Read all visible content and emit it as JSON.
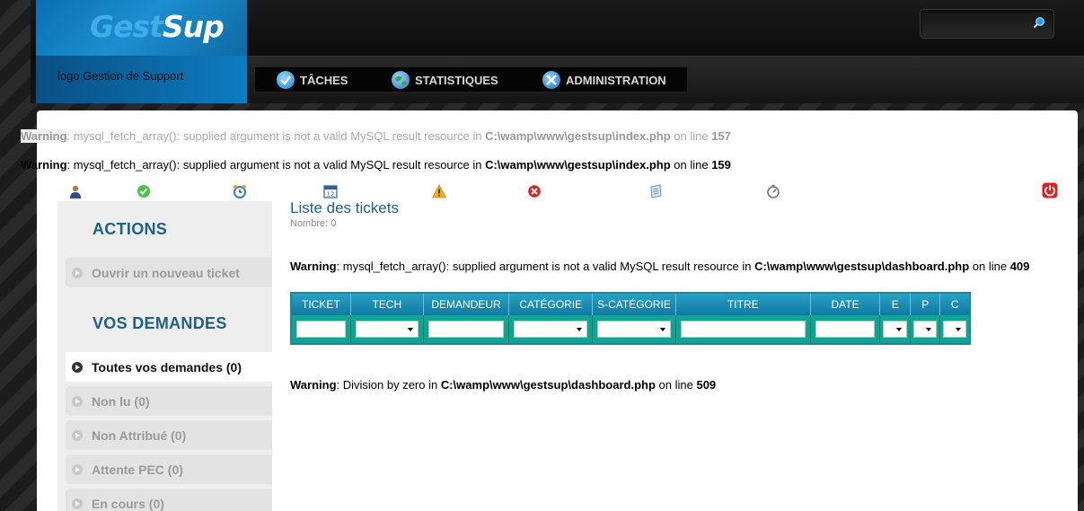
{
  "header": {
    "brand_part1": "Gest",
    "brand_part2": "Sup",
    "logo_label": "logo  Gestion de Support",
    "nav": [
      {
        "label": "TÂCHES",
        "icon": "check-icon",
        "color": "#2e9be0"
      },
      {
        "label": "STATISTIQUES",
        "icon": "globe-icon",
        "color": "#3c8d3f"
      },
      {
        "label": "ADMINISTRATION",
        "icon": "tools-icon",
        "color": "#2b7fc7"
      }
    ],
    "search_placeholder": ""
  },
  "warnings": {
    "w1": {
      "label": "Warning",
      "text": ": mysql_fetch_array(): supplied argument is not a valid MySQL result resource in ",
      "file": "C:\\wamp\\www\\gestsup\\index.php",
      "online": " on line ",
      "line": "157"
    },
    "w2": {
      "label": "Warning",
      "text": ": mysql_fetch_array(): supplied argument is not a valid MySQL result resource in ",
      "file": "C:\\wamp\\www\\gestsup\\index.php",
      "online": " on line ",
      "line": "159"
    },
    "w3": {
      "label": "Warning",
      "text": ": mysql_fetch_array(): supplied argument is not a valid MySQL result resource in ",
      "file": "C:\\wamp\\www\\gestsup\\dashboard.php",
      "online": " on line ",
      "line": "409"
    },
    "w4": {
      "label": "Warning",
      "text": ": Division by zero in ",
      "file": "C:\\wamp\\www\\gestsup\\dashboard.php",
      "online": " on line ",
      "line": "509"
    }
  },
  "toolbar": {
    "icons": [
      "user-icon",
      "check-circle-icon",
      "alarm-clock-icon",
      "calendar-icon",
      "warning-icon",
      "error-icon",
      "notepad-icon",
      "timer-icon",
      "power-icon"
    ],
    "calendar_day": "12"
  },
  "sidebar": {
    "actions_title": "ACTIONS",
    "new_ticket": "Ouvrir un nouveau ticket",
    "requests_title": "VOS DEMANDES",
    "items": [
      {
        "label": "Toutes vos demandes (0)"
      },
      {
        "label": "Non lu (0)"
      },
      {
        "label": "Non Attribué (0)"
      },
      {
        "label": "Attente PEC (0)"
      },
      {
        "label": "En cours (0)"
      }
    ]
  },
  "main": {
    "title": "Liste des tickets",
    "count": "Nombre: 0",
    "columns": [
      "TICKET",
      "TECH",
      "DEMANDEUR",
      "CATÉGORIE",
      "S-CATÉGORIE",
      "TITRE",
      "DATE",
      "E",
      "P",
      "C"
    ]
  },
  "colors": {
    "accent": "#1f5f88",
    "table_header": "#1a8db4",
    "table_filter_row": "#12a393"
  }
}
